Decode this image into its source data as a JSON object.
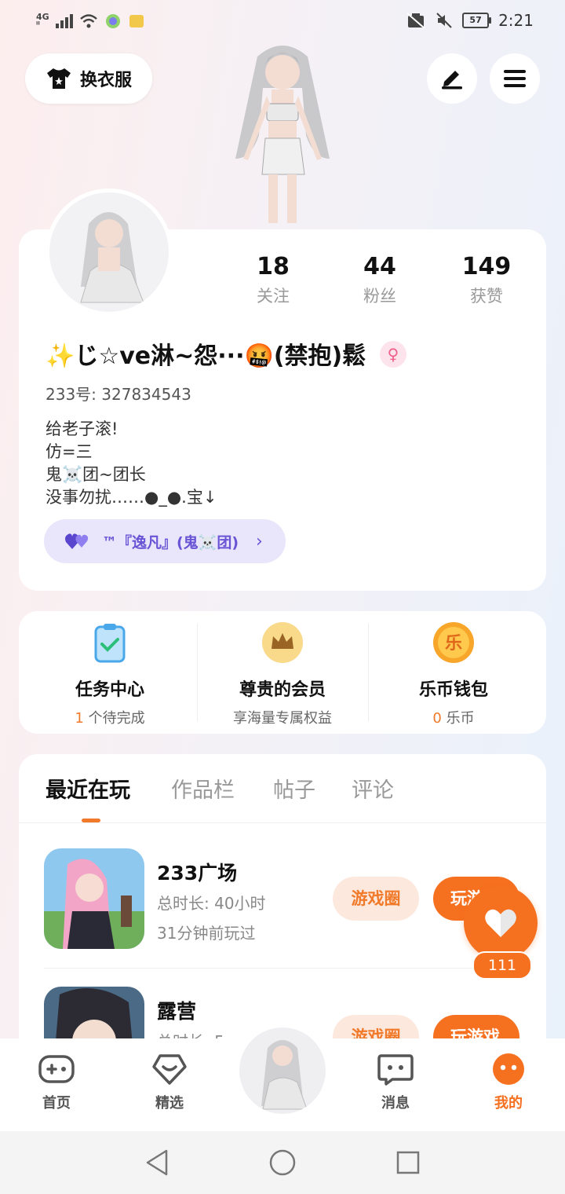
{
  "status_bar": {
    "network": "4G",
    "network_sub": "ⁱˡ",
    "battery": "57",
    "time": "2:21"
  },
  "header": {
    "outfit_label": "换衣服",
    "edit_icon": "pen-icon",
    "menu_icon": "hamburger-icon"
  },
  "profile": {
    "stats": [
      {
        "value": "18",
        "label": "关注"
      },
      {
        "value": "44",
        "label": "粉丝"
      },
      {
        "value": "149",
        "label": "获赞"
      }
    ],
    "nickname": "✨じ☆ve淋~怨···🤬(禁抱)鬆",
    "gender_symbol": "♀",
    "uid": "233号: 327834543",
    "bio": [
      "给老子滚!",
      "仿=三",
      "鬼☠️团~团长",
      "没事勿扰……●_●.宝↓"
    ],
    "guild": "™『逸凡』(鬼☠️团)",
    "guild_chevron": "›"
  },
  "features": [
    {
      "title": "任务中心",
      "sub_count": "1",
      "sub_text": " 个待完成",
      "icon": "clipboard-check-icon"
    },
    {
      "title": "尊贵的会员",
      "sub_count": "",
      "sub_text": "享海量专属权益",
      "icon": "crown-icon"
    },
    {
      "title": "乐币钱包",
      "sub_count": "0",
      "sub_text": " 乐币",
      "icon": "le-coin-icon",
      "coin_char": "乐"
    }
  ],
  "tabs": [
    "最近在玩",
    "作品栏",
    "帖子",
    "评论"
  ],
  "games": [
    {
      "title": "233广场",
      "meta1": "总时长: 40小时",
      "meta2": "31分钟前玩过",
      "circle": "游戏圈",
      "play": "玩游戏"
    },
    {
      "title": "露营",
      "meta1": "总时长: 5",
      "meta2": "",
      "circle": "游戏圈",
      "play": "玩游戏"
    }
  ],
  "like": {
    "count": "111"
  },
  "nav": [
    {
      "label": "首页",
      "icon": "gamepad-icon"
    },
    {
      "label": "精选",
      "icon": "heart-diamond-icon"
    },
    {
      "label": "消息",
      "icon": "chat-icon"
    },
    {
      "label": "我的",
      "icon": "profile-face-icon"
    }
  ],
  "colors": {
    "accent": "#f5701f",
    "guild": "#6a54d6",
    "pill_bg": "#e9e6fb"
  }
}
